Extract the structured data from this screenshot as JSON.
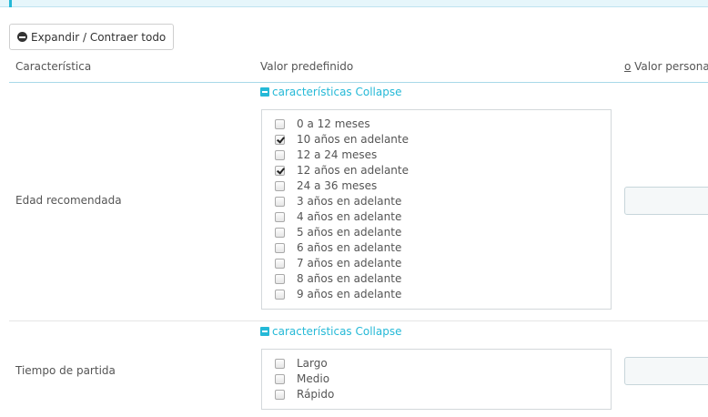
{
  "toolbar": {
    "expand_collapse_label": "Expandir / Contraer todo"
  },
  "table": {
    "headers": {
      "feature": "Característica",
      "default_value": "Valor predefinido",
      "custom_prefix": "o",
      "custom_value": " Valor personal"
    },
    "rows": [
      {
        "label": "Edad recomendada",
        "collapse_label": "características Collapse",
        "options": [
          {
            "label": "0 a 12 meses",
            "checked": false
          },
          {
            "label": "10 años en adelante",
            "checked": true
          },
          {
            "label": "12 a 24 meses",
            "checked": false
          },
          {
            "label": "12 años en adelante",
            "checked": true
          },
          {
            "label": "24 a 36 meses",
            "checked": false
          },
          {
            "label": "3 años en adelante",
            "checked": false
          },
          {
            "label": "4 años en adelante",
            "checked": false
          },
          {
            "label": "5 años en adelante",
            "checked": false
          },
          {
            "label": "6 años en adelante",
            "checked": false
          },
          {
            "label": "7 años en adelante",
            "checked": false
          },
          {
            "label": "8 años en adelante",
            "checked": false
          },
          {
            "label": "9 años en adelante",
            "checked": false
          }
        ]
      },
      {
        "label": "Tiempo de partida",
        "collapse_label": "características Collapse",
        "options": [
          {
            "label": "Largo",
            "checked": false
          },
          {
            "label": "Medio",
            "checked": false
          },
          {
            "label": "Rápido",
            "checked": false
          }
        ]
      }
    ]
  },
  "colors": {
    "accent": "#25b9d7",
    "text": "#555555"
  }
}
